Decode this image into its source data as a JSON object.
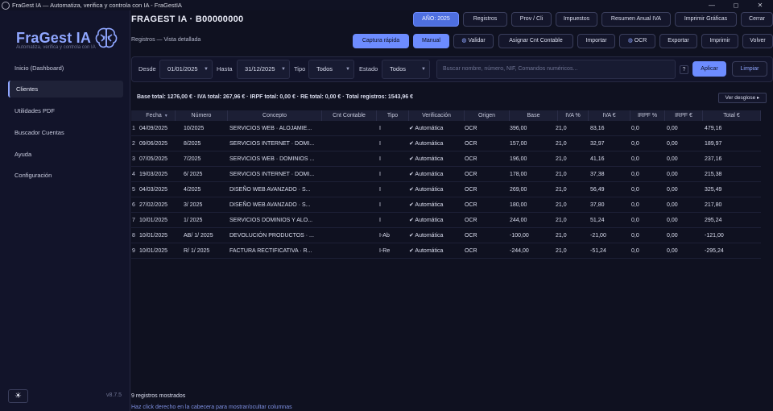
{
  "window": {
    "title": "FraGest IA — Automatiza, verifica y controla con IA - FraGestIA",
    "minimize": "—",
    "maximize": "◻",
    "close": "✕"
  },
  "sidebar": {
    "brand": "FraGest IA",
    "tagline": "Automatiza, verifica y controla con IA",
    "items": [
      {
        "label": "Inicio (Dashboard)"
      },
      {
        "label": "Clientes"
      },
      {
        "label": "Utilidades PDF"
      },
      {
        "label": "Buscador Cuentas"
      },
      {
        "label": "Ayuda"
      },
      {
        "label": "Configuración"
      }
    ],
    "active_item": "Clientes",
    "theme_icon": "☀",
    "version": "v8.7.5"
  },
  "header": {
    "company": "FRAGEST IA  ·  B00000000",
    "subtitle": "Registros — Vista detallada",
    "top_buttons": [
      "AÑO: 2025",
      "Registros",
      "Prov / Cli",
      "Impuestos",
      "Resumen Anual IVA",
      "Imprimir Gráficas",
      "Cerrar"
    ],
    "action_buttons": [
      "Captura rápida",
      "Manual",
      "Validar",
      "Asignar Cnt Contable",
      "Importar",
      "OCR",
      "Exportar",
      "Imprimir",
      "Volver"
    ]
  },
  "filters": {
    "desde_label": "Desde",
    "desde_value": "01/01/2025",
    "hasta_label": "Hasta",
    "hasta_value": "31/12/2025",
    "tipo_label": "Tipo",
    "tipo_value": "Todos",
    "estado_label": "Estado",
    "estado_value": "Todos",
    "search_placeholder": "Buscar nombre, número, NIF, Comandos numéricos...",
    "help": "?",
    "apply": "Aplicar",
    "clear": "Limpiar"
  },
  "totals": {
    "text": "Base total: 1276,00 € · IVA total: 267,96 € · IRPF total: 0,00 € · RE total: 0,00 € · Total registros: 1543,96 €",
    "breakdown_button": "Ver desglose ▸"
  },
  "table": {
    "columns": [
      "Fecha",
      "Número",
      "Concepto",
      "Cnt Contable",
      "Tipo",
      "Verificación",
      "Origen",
      "Base",
      "IVA %",
      "IVA €",
      "IRPF %",
      "IRPF €",
      "Total €"
    ],
    "rows": [
      [
        "1",
        "04/09/2025",
        "10/2025",
        "SERVICIOS WEB · ALOJAMIE...",
        "",
        "I",
        "✔ Automática",
        "OCR",
        "396,00",
        "21,0",
        "83,16",
        "0,0",
        "0,00",
        "479,16"
      ],
      [
        "2",
        "09/06/2025",
        "8/2025",
        "SERVICIOS INTERNET · DOMI...",
        "",
        "I",
        "✔ Automática",
        "OCR",
        "157,00",
        "21,0",
        "32,97",
        "0,0",
        "0,00",
        "189,97"
      ],
      [
        "3",
        "07/05/2025",
        "7/2025",
        "SERVICIOS WEB · DOMINIOS ...",
        "",
        "I",
        "✔ Automática",
        "OCR",
        "196,00",
        "21,0",
        "41,16",
        "0,0",
        "0,00",
        "237,16"
      ],
      [
        "4",
        "19/03/2025",
        "6/ 2025",
        "SERVICIOS INTERNET · DOMI...",
        "",
        "I",
        "✔ Automática",
        "OCR",
        "178,00",
        "21,0",
        "37,38",
        "0,0",
        "0,00",
        "215,38"
      ],
      [
        "5",
        "04/03/2025",
        "4/2025",
        "DISEÑO WEB AVANZADO · S...",
        "",
        "I",
        "✔ Automática",
        "OCR",
        "269,00",
        "21,0",
        "56,49",
        "0,0",
        "0,00",
        "325,49"
      ],
      [
        "6",
        "27/02/2025",
        "3/ 2025",
        "DISEÑO WEB AVANZADO · S...",
        "",
        "I",
        "✔ Automática",
        "OCR",
        "180,00",
        "21,0",
        "37,80",
        "0,0",
        "0,00",
        "217,80"
      ],
      [
        "7",
        "10/01/2025",
        "1/ 2025",
        "SERVICIOS DOMINIOS Y ALO...",
        "",
        "I",
        "✔ Automática",
        "OCR",
        "244,00",
        "21,0",
        "51,24",
        "0,0",
        "0,00",
        "295,24"
      ],
      [
        "8",
        "10/01/2025",
        "AB/ 1/ 2025",
        "DEVOLUCIÓN PRODUCTOS · ...",
        "",
        "I-Ab",
        "✔ Automática",
        "OCR",
        "-100,00",
        "21,0",
        "-21,00",
        "0,0",
        "0,00",
        "-121,00"
      ],
      [
        "9",
        "10/01/2025",
        "R/ 1/ 2025",
        "FACTURA RECTIFICATIVA · R...",
        "",
        "I-Re",
        "✔ Automática",
        "OCR",
        "-244,00",
        "21,0",
        "-51,24",
        "0,0",
        "0,00",
        "-295,24"
      ]
    ]
  },
  "footer": {
    "count": "9 registros mostrados",
    "hint": "Haz click derecho en la cabecera para mostrar/ocultar columnas"
  }
}
